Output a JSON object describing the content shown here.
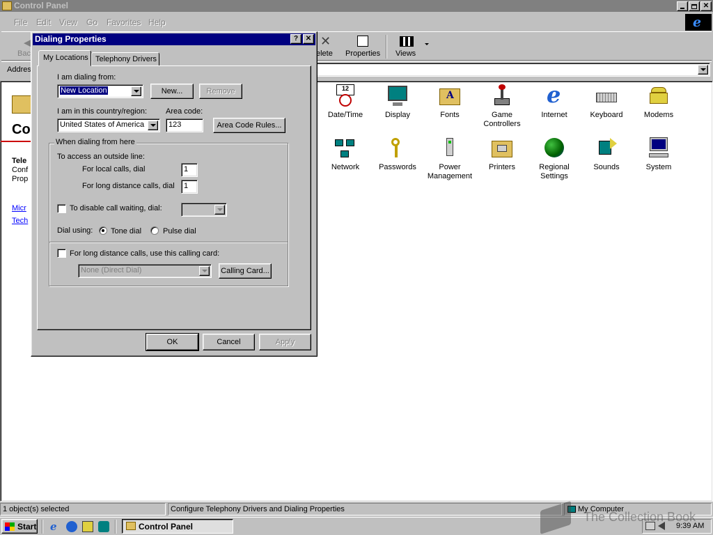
{
  "main_window": {
    "title": "Control Panel",
    "menu": [
      "File",
      "Edit",
      "View",
      "Go",
      "Favorites",
      "Help"
    ],
    "toolbar": {
      "back": "Bac",
      "delete": "elete",
      "properties": "Properties",
      "views": "Views"
    },
    "address_label": "Addres",
    "left_pane": {
      "heading": "Co",
      "desc_title": "Tele",
      "desc_lines": [
        "Conf",
        "Prop"
      ],
      "links": [
        "Micr",
        "Tech"
      ]
    },
    "icons": [
      {
        "name": "Date/Time",
        "icon": "clock-calendar-icon"
      },
      {
        "name": "Display",
        "icon": "monitor-icon"
      },
      {
        "name": "Fonts",
        "icon": "fonts-folder-icon"
      },
      {
        "name": "Game Controllers",
        "icon": "joystick-icon"
      },
      {
        "name": "Internet",
        "icon": "internet-explorer-icon"
      },
      {
        "name": "Keyboard",
        "icon": "keyboard-icon"
      },
      {
        "name": "Modems",
        "icon": "telephone-modem-icon"
      },
      {
        "name": "Network",
        "icon": "network-icon"
      },
      {
        "name": "Passwords",
        "icon": "keys-icon"
      },
      {
        "name": "Power Management",
        "icon": "power-plug-icon"
      },
      {
        "name": "Printers",
        "icon": "printers-folder-icon"
      },
      {
        "name": "Regional Settings",
        "icon": "globe-icon"
      },
      {
        "name": "Sounds",
        "icon": "speaker-icon"
      },
      {
        "name": "System",
        "icon": "computer-icon"
      }
    ],
    "status": {
      "selected": "1 object(s) selected",
      "description": "Configure Telephony Drivers and Dialing Properties",
      "zone": "My Computer"
    }
  },
  "dialog": {
    "title": "Dialing Properties",
    "tabs": [
      "My Locations",
      "Telephony Drivers"
    ],
    "dialing_from_label": "I am dialing from:",
    "location_value": "New Location",
    "new_button": "New...",
    "remove_button": "Remove",
    "country_label": "I am in this country/region:",
    "country_value": "United States of America",
    "area_code_label": "Area code:",
    "area_code_value": "123",
    "area_code_rules_button": "Area Code Rules...",
    "group_title": "When dialing from here",
    "outside_line_label": "To access an outside line:",
    "local_calls_label": "For local calls, dial",
    "local_calls_value": "1",
    "long_distance_label": "For long distance calls, dial",
    "long_distance_value": "1",
    "call_waiting_label": "To disable call waiting, dial:",
    "dial_using_label": "Dial using:",
    "tone_label": "Tone dial",
    "pulse_label": "Pulse dial",
    "calling_card_check_label": "For long distance calls, use this calling card:",
    "calling_card_value": "None (Direct Dial)",
    "calling_card_button": "Calling Card...",
    "ok_button": "OK",
    "cancel_button": "Cancel",
    "apply_button": "Apply"
  },
  "taskbar": {
    "start": "Start",
    "task": "Control Panel",
    "clock": "9:39 AM"
  },
  "watermark": "The Collection Book",
  "colors": {
    "desktop": "#c0c0c0",
    "active_title": "#000080",
    "inactive_title": "#808080",
    "selection": "#000080"
  }
}
